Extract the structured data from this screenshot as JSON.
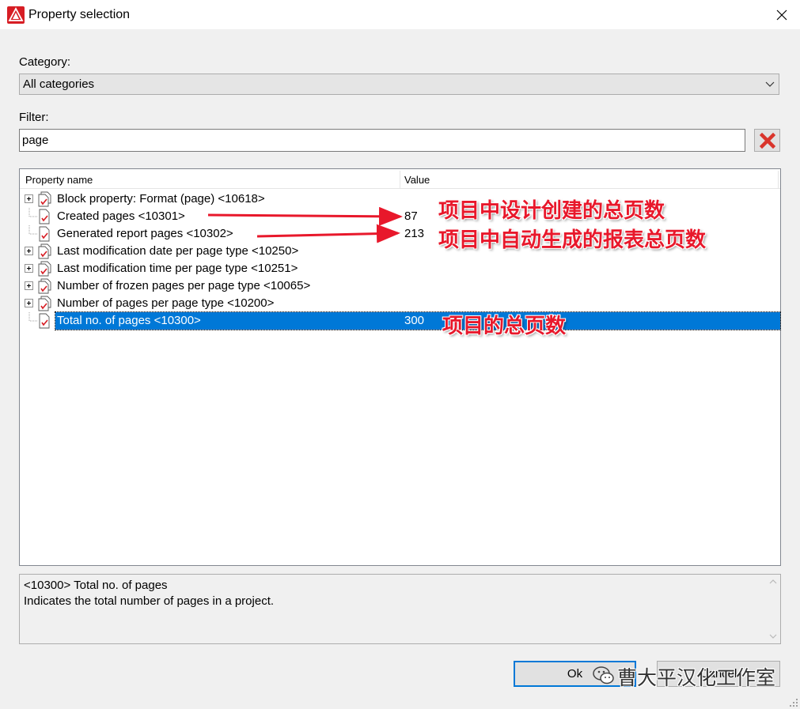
{
  "window": {
    "title": "Property selection"
  },
  "category": {
    "label": "Category:",
    "selected": "All categories"
  },
  "filter": {
    "label": "Filter:",
    "value": "page"
  },
  "table": {
    "headers": {
      "name": "Property name",
      "value": "Value"
    },
    "rows": [
      {
        "name": "Block property: Format (page) <10618>",
        "value": "",
        "expandable": true,
        "icon": "multi-property-icon"
      },
      {
        "name": "Created pages <10301>",
        "value": "87",
        "expandable": false,
        "icon": "property-icon"
      },
      {
        "name": "Generated report pages <10302>",
        "value": "213",
        "expandable": false,
        "icon": "property-icon"
      },
      {
        "name": "Last modification date per page type <10250>",
        "value": "",
        "expandable": true,
        "icon": "multi-property-icon"
      },
      {
        "name": "Last modification time per page type <10251>",
        "value": "",
        "expandable": true,
        "icon": "multi-property-icon"
      },
      {
        "name": "Number of frozen pages per page type <10065>",
        "value": "",
        "expandable": true,
        "icon": "multi-property-icon"
      },
      {
        "name": "Number of pages per page type <10200>",
        "value": "",
        "expandable": true,
        "icon": "multi-property-icon"
      },
      {
        "name": "Total no. of pages <10300>",
        "value": "300",
        "expandable": false,
        "icon": "property-icon",
        "selected": true
      }
    ]
  },
  "description": {
    "line1": "<10300> Total no. of pages",
    "line2": "Indicates the total number of pages in a project."
  },
  "buttons": {
    "ok": "Ok",
    "cancel": "Cancel"
  },
  "annotations": {
    "created": "项目中设计创建的总页数",
    "generated": "项目中自动生成的报表总页数",
    "total": "项目的总页数"
  },
  "watermark": "曹大平汉化工作室",
  "colors": {
    "selection": "#0078d7",
    "annotation": "#e8182b",
    "clear_x": "#d9342b"
  }
}
